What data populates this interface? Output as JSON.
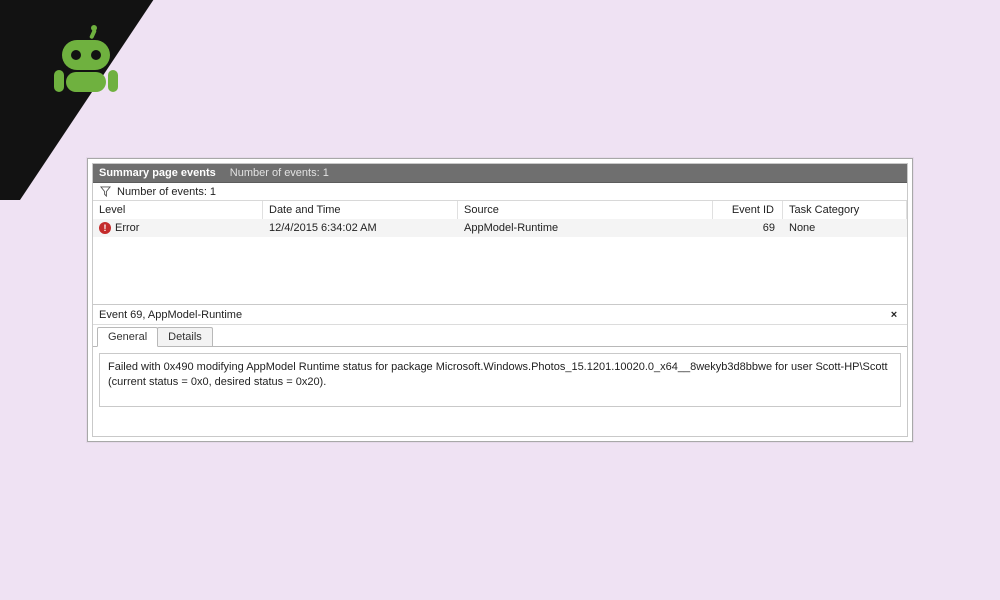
{
  "header": {
    "title": "Summary page events",
    "subtitle": "Number of events: 1"
  },
  "filter": {
    "count_label": "Number of events: 1"
  },
  "columns": {
    "level": "Level",
    "datetime": "Date and Time",
    "source": "Source",
    "eventid": "Event ID",
    "taskcat": "Task Category"
  },
  "rows": [
    {
      "level": "Error",
      "datetime": "12/4/2015 6:34:02 AM",
      "source": "AppModel-Runtime",
      "eventid": "69",
      "taskcat": "None"
    }
  ],
  "detail": {
    "header": "Event 69, AppModel-Runtime",
    "tabs": {
      "general": "General",
      "details": "Details"
    },
    "message": "Failed with 0x490 modifying AppModel Runtime status for package Microsoft.Windows.Photos_15.1201.10020.0_x64__8wekyb3d8bbwe for user Scott-HP\\Scott (current status = 0x0, desired status = 0x20)."
  }
}
